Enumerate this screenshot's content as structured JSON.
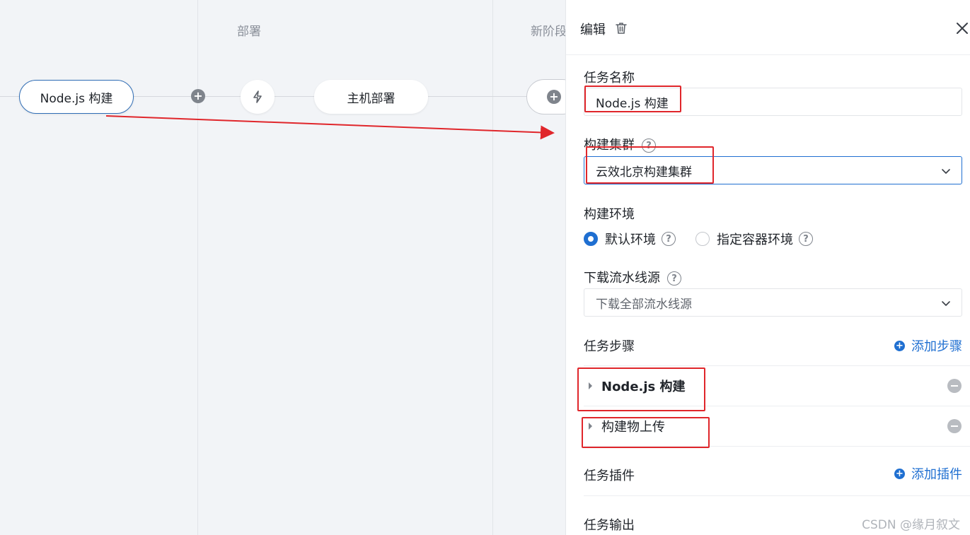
{
  "canvas": {
    "stages": [
      {
        "title": "部署"
      },
      {
        "title": "新阶段"
      }
    ],
    "nodes": {
      "build": "Node.js 构建",
      "deploy": "主机部署"
    }
  },
  "panel": {
    "header": {
      "title": "编辑"
    },
    "task_name": {
      "label": "任务名称",
      "value": "Node.js 构建"
    },
    "build_cluster": {
      "label": "构建集群",
      "value": "云效北京构建集群"
    },
    "build_env": {
      "label": "构建环境",
      "options": [
        {
          "label": "默认环境",
          "selected": true
        },
        {
          "label": "指定容器环境",
          "selected": false
        }
      ]
    },
    "download_source": {
      "label": "下载流水线源",
      "value": "下载全部流水线源"
    },
    "task_steps": {
      "label": "任务步骤",
      "add_label": "添加步骤",
      "items": [
        {
          "label": "Node.js 构建"
        },
        {
          "label": "构建物上传"
        }
      ]
    },
    "task_plugins": {
      "label": "任务插件",
      "add_label": "添加插件"
    },
    "task_output": {
      "label": "任务输出"
    }
  },
  "watermark": "CSDN @缘月叙文",
  "colors": {
    "accent": "#1f6fd1",
    "annotation_red": "#e0262b",
    "canvas_bg": "#f2f4f7"
  }
}
